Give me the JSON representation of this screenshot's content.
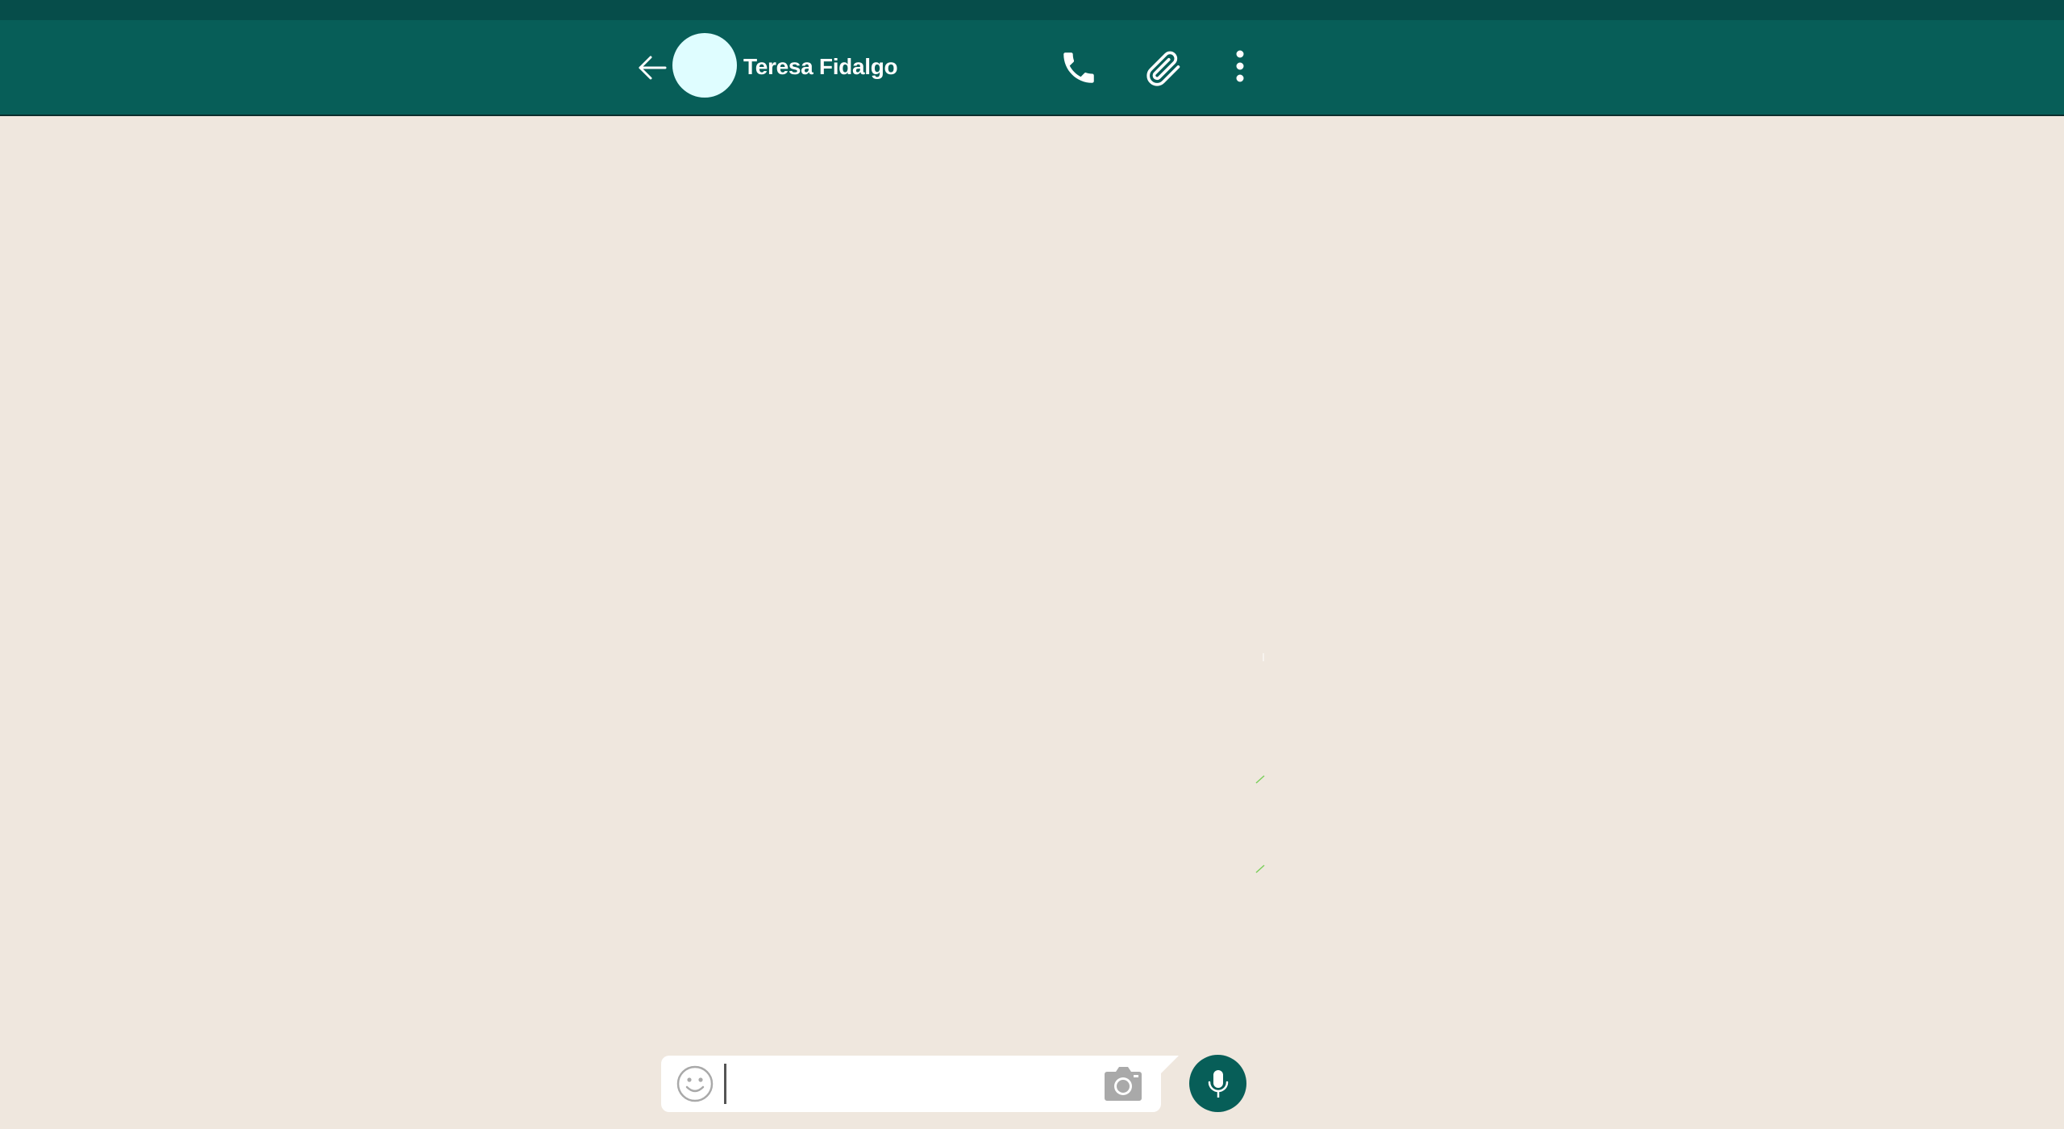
{
  "app": {
    "colors": {
      "status_bar": "#064D4A",
      "header": "#075E58",
      "chat_background": "#EFE7DE",
      "avatar": "#DFFDFF",
      "icon_gray": "#A9A9A9"
    }
  },
  "header": {
    "back_icon": "arrow-left-icon",
    "contact_name": "Teresa Fidalgo",
    "actions": [
      {
        "name": "call",
        "icon": "phone-icon"
      },
      {
        "name": "attach",
        "icon": "paperclip-icon"
      },
      {
        "name": "menu",
        "icon": "more-vertical-icon"
      }
    ]
  },
  "composer": {
    "emoji_icon": "smiley-icon",
    "message_value": "",
    "message_placeholder": "",
    "camera_icon": "camera-icon",
    "send_icon": "microphone-icon"
  }
}
